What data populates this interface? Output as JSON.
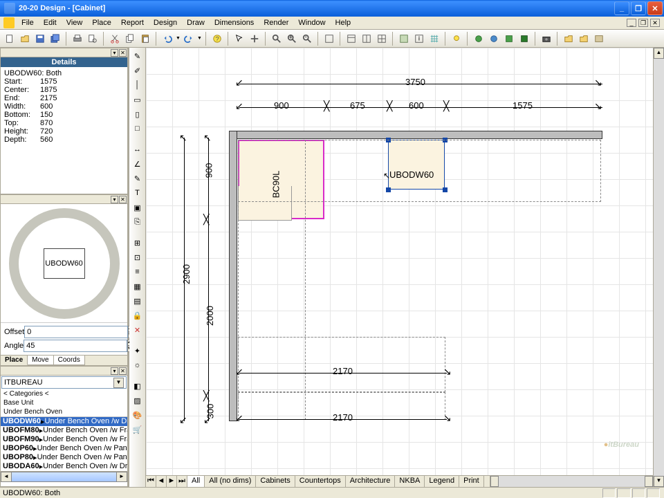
{
  "window": {
    "title": "20-20 Design - [Cabinet]",
    "min_label": "_",
    "max_label": "❐",
    "close_label": "✕"
  },
  "menu": {
    "items": [
      "File",
      "Edit",
      "View",
      "Place",
      "Report",
      "Design",
      "Draw",
      "Dimensions",
      "Render",
      "Window",
      "Help"
    ]
  },
  "details": {
    "title": "Details",
    "header": "UBODW60:  Both",
    "rows": [
      {
        "k": "Start:",
        "v": "1575"
      },
      {
        "k": "Center:",
        "v": "1875"
      },
      {
        "k": "End:",
        "v": "2175"
      },
      {
        "k": "Width:",
        "v": "600"
      },
      {
        "k": "Bottom:",
        "v": "150"
      },
      {
        "k": "Top:",
        "v": "870"
      },
      {
        "k": "Height:",
        "v": "720"
      },
      {
        "k": "Depth:",
        "v": "560"
      }
    ]
  },
  "preview": {
    "label": "UBODW60"
  },
  "placement": {
    "offset_label": "Offset",
    "offset_value": "0",
    "angle_label": "Angle",
    "angle_value": "45",
    "tabs": [
      "Place",
      "Move",
      "Coords"
    ],
    "active_tab": 0
  },
  "catalog": {
    "combo": "ITBUREAU",
    "crumbs": [
      "< Categories <",
      "Base Unit",
      "Under Bench Oven"
    ],
    "items": [
      {
        "code": "UBODW60",
        "desc": "Under Bench Oven /w Draw",
        "sel": true
      },
      {
        "code": "UBOFM80",
        "desc": "Under Bench Oven /w Fram",
        "sel": false
      },
      {
        "code": "UBOFM90",
        "desc": "Under Bench Oven /w Fram",
        "sel": false
      },
      {
        "code": "UBOP60",
        "desc": "Under Bench Oven /w Pane",
        "sel": false
      },
      {
        "code": "UBOP80",
        "desc": "Under Bench Oven /w Pane",
        "sel": false
      },
      {
        "code": "UBODA60",
        "desc": "Under Bench Oven /w Draw",
        "sel": false
      }
    ]
  },
  "canvas": {
    "dims_top_overall": "3750",
    "dims_top": [
      "900",
      "675",
      "600",
      "1575"
    ],
    "dims_left": [
      "900",
      "2900",
      "2000",
      "300"
    ],
    "dims_bottom": [
      "2170",
      "2170"
    ],
    "cab1_label": "BC90L",
    "cab2_label": "UBODW60",
    "tabs": [
      "All",
      "All (no dims)",
      "Cabinets",
      "Countertops",
      "Architecture",
      "NKBA",
      "Legend",
      "Print"
    ],
    "active_tab": 0,
    "logo": "itBureau"
  },
  "status": {
    "text": "UBODW60:  Both"
  }
}
